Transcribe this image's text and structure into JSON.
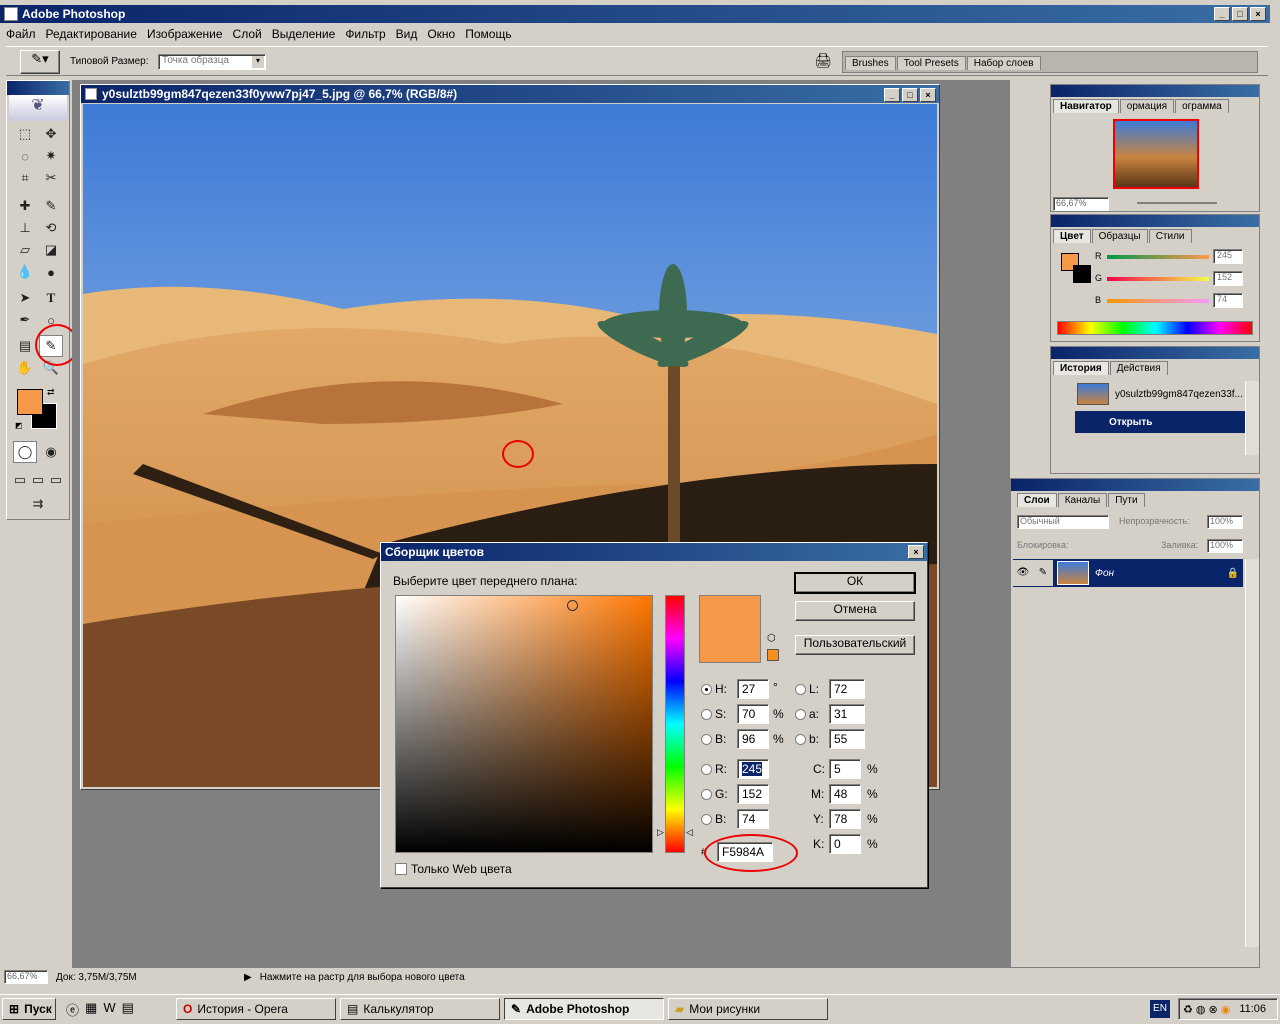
{
  "app": {
    "title": "Adobe Photoshop"
  },
  "menu": [
    "Файл",
    "Редактирование",
    "Изображение",
    "Слой",
    "Выделение",
    "Фильтр",
    "Вид",
    "Окно",
    "Помощь"
  ],
  "options_bar": {
    "sample_size_label": "Типовой Размер:",
    "sample_size_value": "Точка образца",
    "palette_tabs": [
      "Brushes",
      "Tool Presets",
      "Набор слоев"
    ]
  },
  "document": {
    "title": "y0sulztb99gm847qezen33f0yww7pj47_5.jpg @ 66,7% (RGB/8#)"
  },
  "navigator": {
    "tabs": [
      "Навигатор",
      "ормация",
      "ограмма"
    ],
    "zoom": "66,67%"
  },
  "color_panel": {
    "tabs": [
      "Цвет",
      "Образцы",
      "Стили"
    ],
    "r": "245",
    "g": "152",
    "b": "74",
    "r_label": "R",
    "g_label": "G",
    "b_label": "B"
  },
  "history": {
    "tabs": [
      "История",
      "Действия"
    ],
    "snapshot": "y0sulztb99gm847qezen33f...",
    "step": "Открыть"
  },
  "layers": {
    "tabs": [
      "Слои",
      "Каналы",
      "Пути"
    ],
    "blend": "Обычный",
    "opacity_label": "Непрозрачность:",
    "opacity": "100%",
    "lock_label": "Блокировка:",
    "fill_label": "Заливка:",
    "fill": "100%",
    "layer_name": "Фон"
  },
  "picker": {
    "title": "Сборщик цветов",
    "prompt": "Выберите цвет переднего плана:",
    "ok": "ОК",
    "cancel": "Отмена",
    "custom": "Пользовательский",
    "h_label": "H:",
    "h": "27",
    "h_unit": "°",
    "s_label": "S:",
    "s": "70",
    "s_unit": "%",
    "bb_label": "B:",
    "bb": "96",
    "bb_unit": "%",
    "r_label": "R:",
    "r": "245",
    "g_label": "G:",
    "g": "152",
    "b_label": "B:",
    "b": "74",
    "l_label": "L:",
    "l": "72",
    "a_label": "a:",
    "a": "31",
    "lb_label": "b:",
    "lb": "55",
    "c_label": "C:",
    "c": "5",
    "m_label": "M:",
    "m": "48",
    "y_label": "Y:",
    "y": "78",
    "k_label": "K:",
    "k": "0",
    "pct": "%",
    "hash": "#",
    "hex": "F5984A",
    "web_only": "Только Web цвета",
    "color": "#F5984A"
  },
  "status": {
    "zoom": "66,67%",
    "doc": "Док: 3,75M/3,75M",
    "hint": "Нажмите на растр для выбора нового цвета"
  },
  "taskbar": {
    "start": "Пуск",
    "items": [
      "История - Opera",
      "Калькулятор",
      "Adobe Photoshop",
      "Мои рисунки"
    ],
    "lang": "EN",
    "clock": "11:06"
  }
}
